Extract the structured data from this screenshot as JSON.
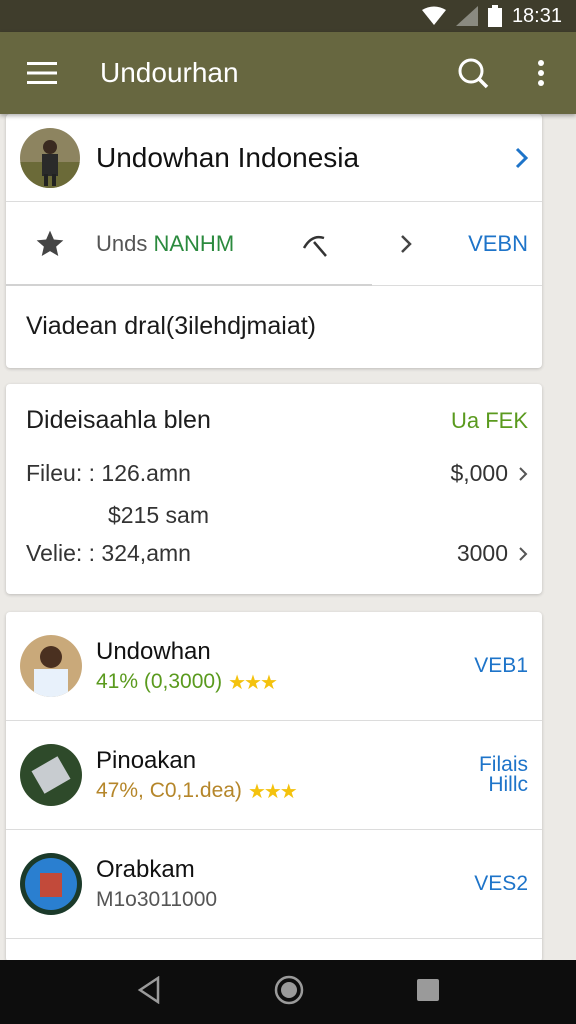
{
  "status": {
    "time": "18:31"
  },
  "appbar": {
    "title": "Undourhan"
  },
  "profile": {
    "name": "Undowhan Indonesia"
  },
  "actions": {
    "label_a": "Unds ",
    "label_b": "NANHM",
    "link": "VEBN"
  },
  "note": "Viadean dral(3ilehdjmaiat)",
  "details": {
    "title": "Dideisaahla blen",
    "tag": "Ua FEK",
    "rows": [
      {
        "label": "Fileu: : 126.amn",
        "value": "$,000"
      },
      {
        "label": "$215 sam",
        "value": ""
      },
      {
        "label": "Velie: : 324,amn",
        "value": "3000"
      }
    ]
  },
  "list": [
    {
      "title": "Undowhan",
      "sub": "41% (0,3000)",
      "sub_color": "#5a9a1e",
      "rating": "★★★",
      "link": "VEB1",
      "link2": ""
    },
    {
      "title": "Pinoakan",
      "sub": "47%, C0,1.dea)",
      "sub_color": "#b5862a",
      "rating": "★★★",
      "link": "Filais",
      "link2": "Hillc"
    },
    {
      "title": "Orabkam",
      "sub": "M1o3011000",
      "sub_color": "#555555",
      "rating": "",
      "link": "VES2",
      "link2": ""
    }
  ],
  "icons": {
    "menu": "menu-icon",
    "search": "search-icon",
    "more": "more-vert-icon",
    "star": "star-icon",
    "pick": "pickaxe-icon",
    "chevron": "chevron-right-icon",
    "back": "back-icon",
    "home": "home-icon",
    "recents": "recents-icon"
  },
  "colors": {
    "appbar": "#676740",
    "statusbar": "#3f3d2c",
    "link": "#1e74c9",
    "green": "#5a9a1e"
  }
}
